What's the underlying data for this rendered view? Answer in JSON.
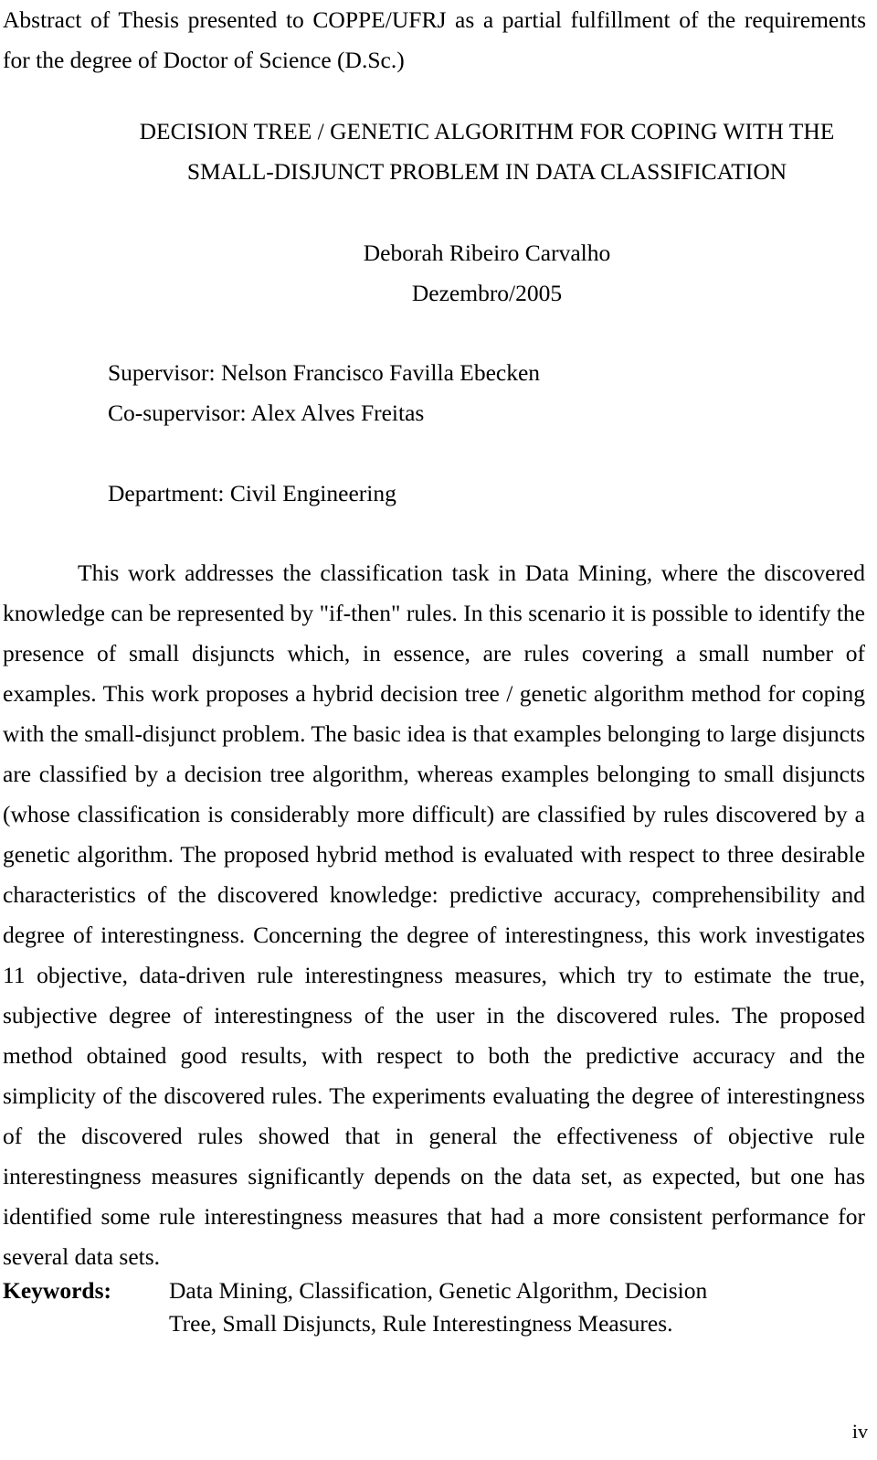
{
  "document": {
    "header": {
      "line1": "Abstract of Thesis presented to COPPE/UFRJ as a partial fulfillment of the requirements",
      "line2": "for the degree of Doctor of Science (D.Sc.)"
    },
    "title": {
      "line1": "DECISION TREE / GENETIC ALGORITHM FOR COPING WITH THE",
      "line2": "SMALL-DISJUNCT PROBLEM IN DATA CLASSIFICATION"
    },
    "author": {
      "name": "Deborah Ribeiro Carvalho",
      "date": "Dezembro/2005"
    },
    "supervisors": {
      "supervisor": "Supervisor: Nelson Francisco Favilla Ebecken",
      "co_supervisor": "Co-supervisor: Alex Alves Freitas"
    },
    "department": "Department: Civil Engineering",
    "abstract": "This work addresses the classification task in Data Mining, where the discovered knowledge can be represented by \"if-then\" rules. In this scenario it is possible to identify the presence of small disjuncts which, in essence, are rules covering a small number of examples. This work proposes a hybrid decision tree / genetic algorithm method for coping with the small-disjunct problem. The basic idea is that examples belonging to large disjuncts are classified by a decision tree algorithm, whereas examples belonging to small disjuncts (whose classification is considerably more difficult) are classified by rules discovered by a genetic algorithm. The proposed hybrid method is evaluated with respect to three desirable characteristics of the discovered knowledge: predictive accuracy, comprehensibility and degree of interestingness. Concerning the degree of interestingness, this work investigates 11 objective, data-driven rule interestingness measures, which try to estimate the true, subjective degree of interestingness of the user in the discovered rules. The proposed method obtained good results, with respect to both the predictive accuracy and the simplicity of the discovered rules. The experiments evaluating the degree of interestingness of the discovered rules showed that in general the effectiveness of objective rule interestingness measures significantly depends on the data set, as expected, but one has identified some rule interestingness measures that had a more consistent performance for several data sets.",
    "keywords": {
      "label": "Keywords:",
      "value": "Data Mining, Classification, Genetic Algorithm, Decision Tree, Small Disjuncts, Rule Interestingness Measures."
    },
    "page_number": "iv"
  }
}
